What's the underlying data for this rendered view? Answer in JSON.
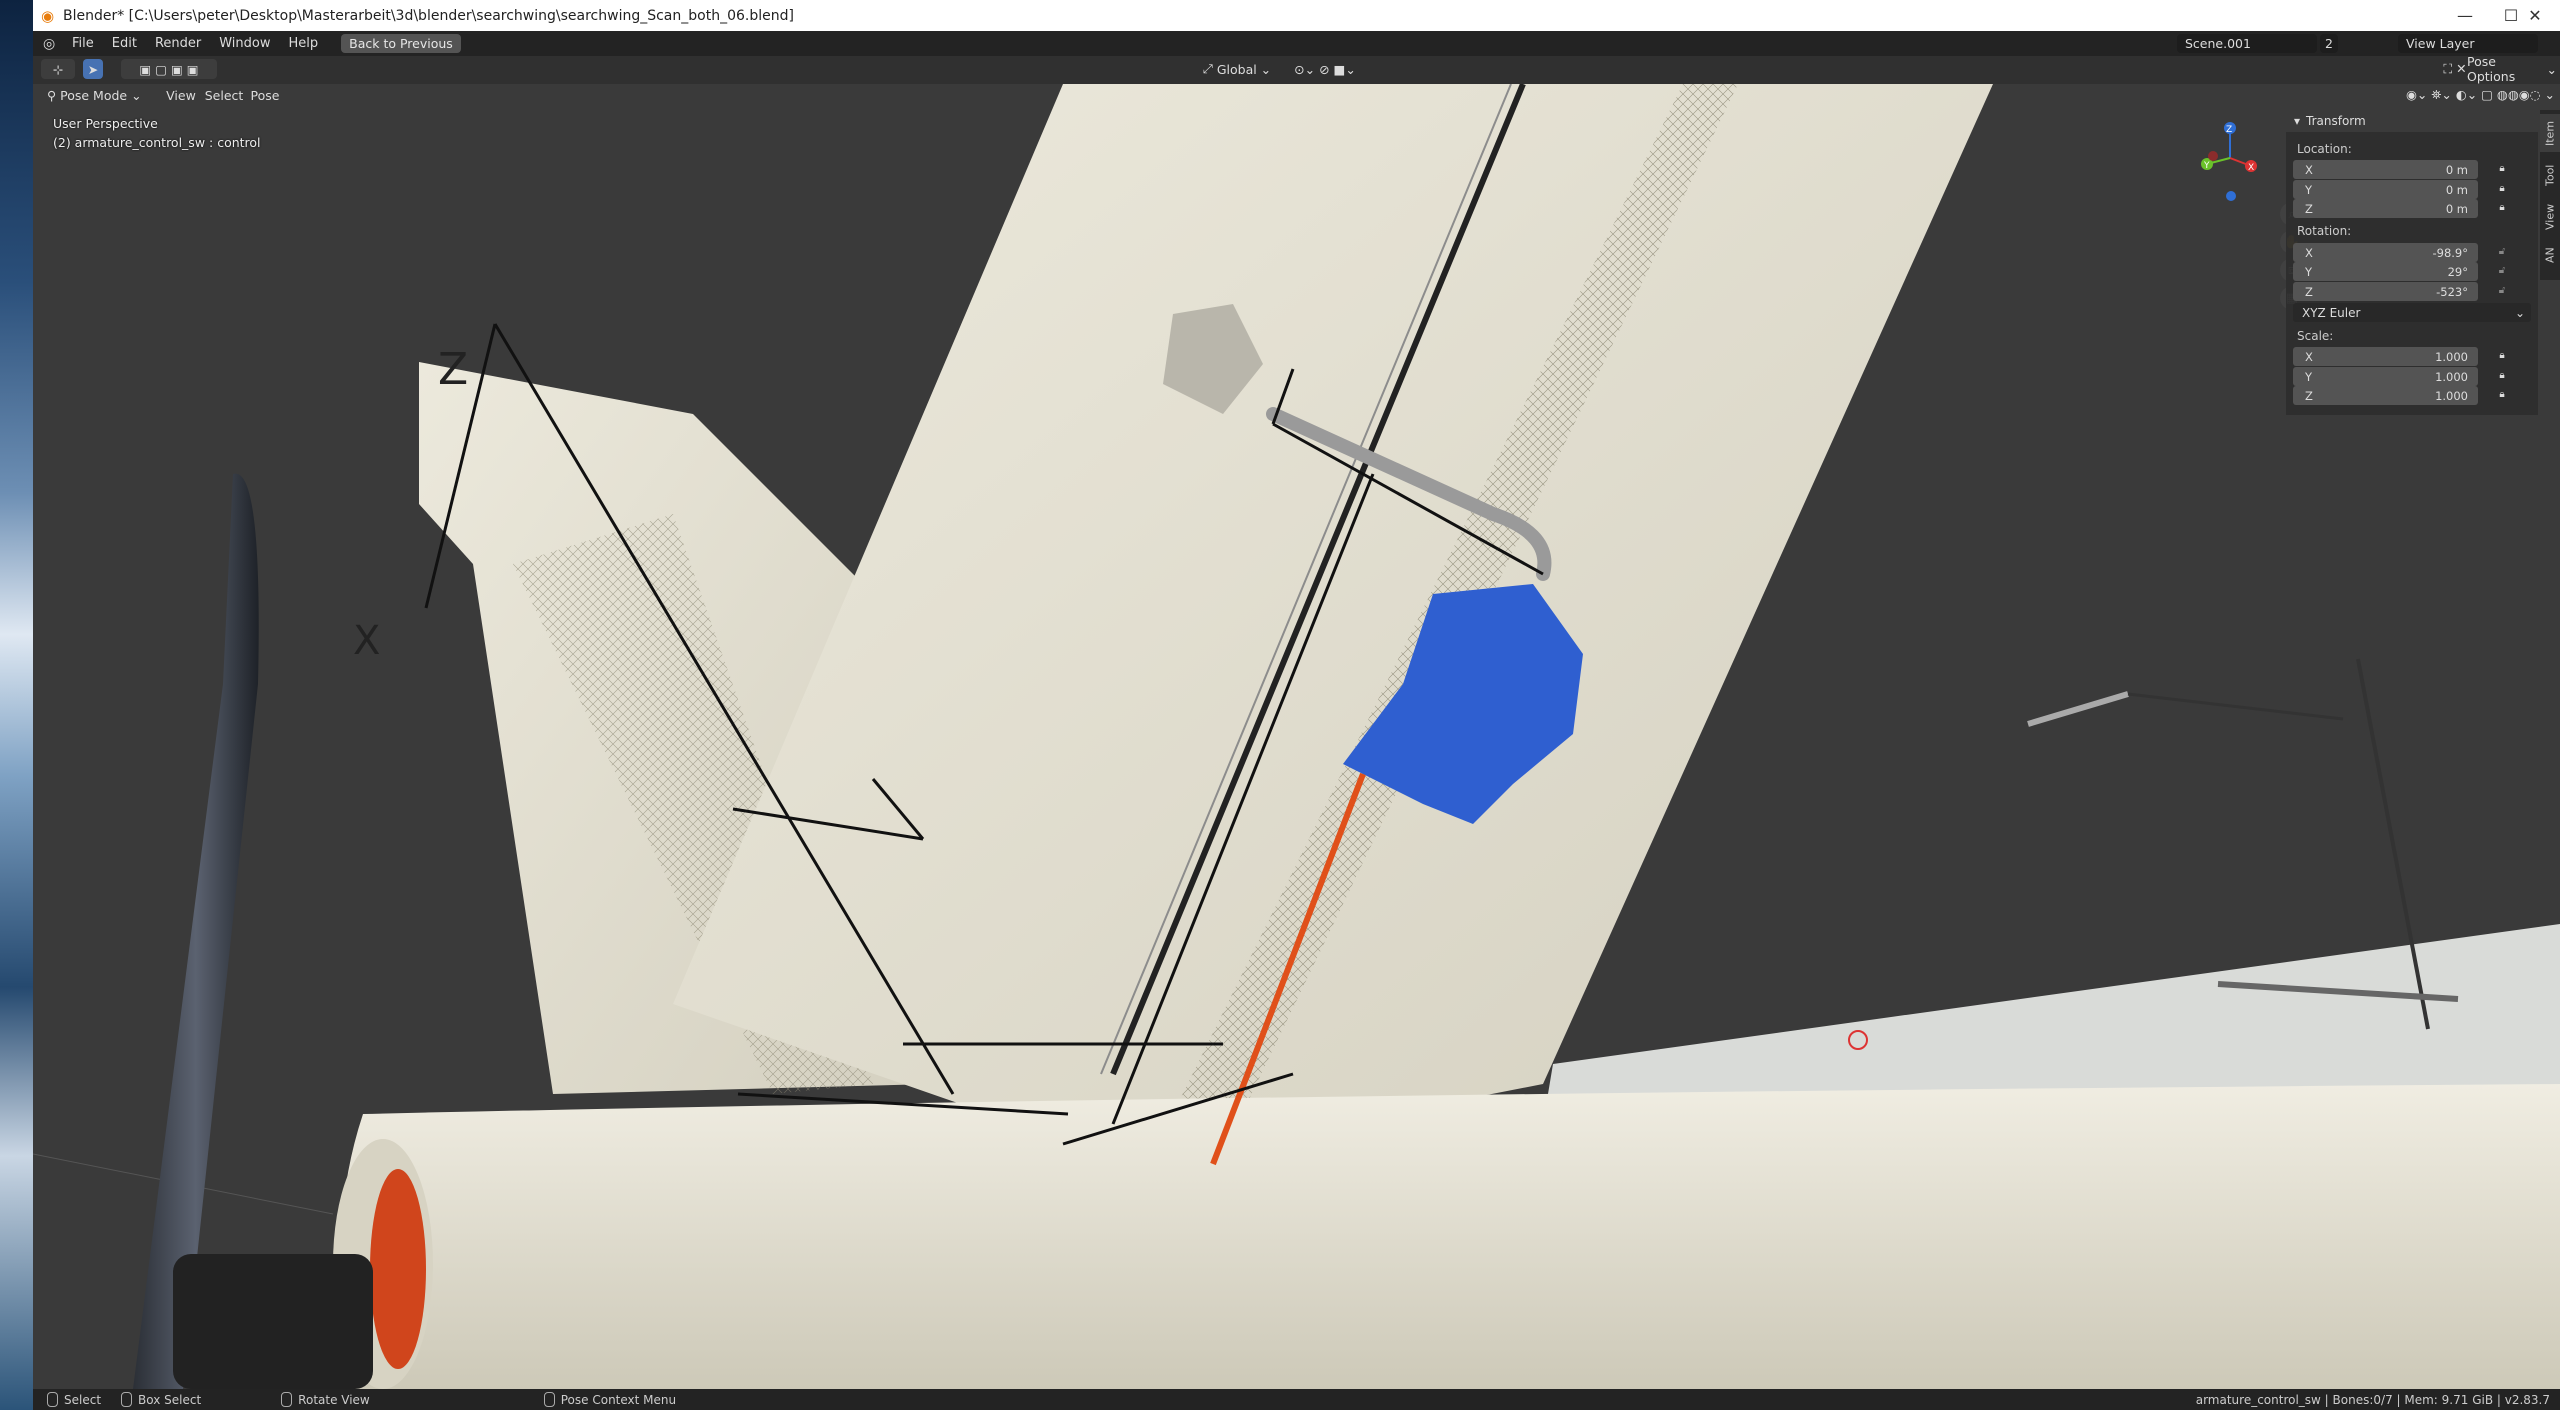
{
  "window": {
    "title": "Blender* [C:\\Users\\peter\\Desktop\\Masterarbeit\\3d\\blender\\searchwing\\searchwing_Scan_both_06.blend]",
    "controls": {
      "minimize": "—",
      "maximize": "☐",
      "close": "✕"
    }
  },
  "menu": {
    "items": [
      "File",
      "Edit",
      "Render",
      "Window",
      "Help"
    ],
    "back_button": "Back to Previous"
  },
  "scene": {
    "name": "Scene.001",
    "users": "2",
    "view_layer": "View Layer"
  },
  "header": {
    "orientation": "Global",
    "pose_options": "Pose Options",
    "mode": "Pose Mode",
    "view_menu": [
      "View",
      "Select",
      "Pose"
    ]
  },
  "viewport": {
    "perspective": "User Perspective",
    "active_object": "(2) armature_control_sw : control"
  },
  "gizmo": {
    "x": "X",
    "y": "Y",
    "z": "Z"
  },
  "npanel": {
    "section": "Transform",
    "location_label": "Location:",
    "location": [
      {
        "axis": "X",
        "value": "0 m"
      },
      {
        "axis": "Y",
        "value": "0 m"
      },
      {
        "axis": "Z",
        "value": "0 m"
      }
    ],
    "rotation_label": "Rotation:",
    "rotation": [
      {
        "axis": "X",
        "value": "-98.9°"
      },
      {
        "axis": "Y",
        "value": "29°"
      },
      {
        "axis": "Z",
        "value": "-523°"
      }
    ],
    "rotation_mode": "XYZ Euler",
    "scale_label": "Scale:",
    "scale": [
      {
        "axis": "X",
        "value": "1.000"
      },
      {
        "axis": "Y",
        "value": "1.000"
      },
      {
        "axis": "Z",
        "value": "1.000"
      }
    ],
    "tabs": [
      "Item",
      "Tool",
      "View",
      "AN"
    ]
  },
  "statusbar": {
    "select": "Select",
    "box_select": "Box Select",
    "rotate_view": "Rotate View",
    "context_menu": "Pose Context Menu",
    "info": "armature_control_sw | Bones:0/7 | Mem: 9.71 GiB | v2.83.7"
  },
  "colors": {
    "accent": "#4772b3",
    "servo_blue": "#2f5fd0",
    "rod_orange": "#e0501a",
    "foam": "#e6e2d2"
  },
  "icons": [
    "blender-logo-icon",
    "select-tool-icon",
    "lock-icon",
    "zoom-icon",
    "hand-icon",
    "camera-icon",
    "grid-icon"
  ]
}
